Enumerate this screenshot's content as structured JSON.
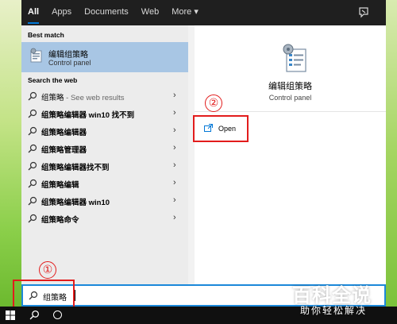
{
  "nav": {
    "tabs": [
      "All",
      "Apps",
      "Documents",
      "Web",
      "More ▾"
    ],
    "active_tab": "All"
  },
  "left": {
    "best_match_heading": "Best match",
    "best_match": {
      "title": "编辑组策略",
      "subtitle": "Control panel",
      "icon": "group-policy-icon"
    },
    "web_heading": "Search the web",
    "web_results": [
      {
        "bold": "组策略",
        "suffix": " - See web results"
      },
      {
        "bold": "组策略编辑器 win10 找不到",
        "suffix": ""
      },
      {
        "bold": "组策略编辑器",
        "suffix": ""
      },
      {
        "bold": "组策略管理器",
        "suffix": ""
      },
      {
        "bold": "组策略编辑器找不到",
        "suffix": ""
      },
      {
        "bold": "组策略编辑",
        "suffix": ""
      },
      {
        "bold": "组策略编辑器 win10",
        "suffix": ""
      },
      {
        "bold": "组策略命令",
        "suffix": ""
      }
    ]
  },
  "right": {
    "app_name": "编辑组策略",
    "app_type": "Control panel",
    "open_label": "Open"
  },
  "search": {
    "value": "组策略"
  },
  "markers": {
    "one": "①",
    "two": "②"
  },
  "watermark": {
    "title": "百科全说",
    "subtitle": "助你轻松解决"
  },
  "colors": {
    "accent": "#0078d7",
    "selection": "#a8c6e4",
    "annotation": "#e21c1c"
  }
}
